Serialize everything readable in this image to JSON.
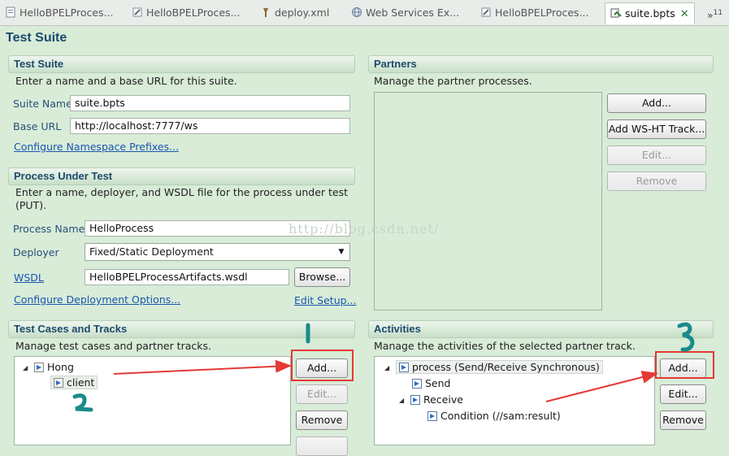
{
  "tabs": [
    {
      "label": "HelloBPELProces...",
      "icon": "bpel-file-icon"
    },
    {
      "label": "HelloBPELProces...",
      "icon": "bpel-editor-icon"
    },
    {
      "label": "deploy.xml",
      "icon": "deploy-file-icon"
    },
    {
      "label": "Web Services Ex...",
      "icon": "globe-icon"
    },
    {
      "label": "HelloBPELProces...",
      "icon": "bpel-editor-icon"
    },
    {
      "label": "suite.bpts",
      "icon": "test-suite-icon",
      "active": true
    }
  ],
  "page_title": "Test Suite",
  "test_suite": {
    "header": "Test Suite",
    "description": "Enter a name and a base URL for this suite.",
    "suite_name_label": "Suite Name",
    "suite_name_value": "suite.bpts",
    "base_url_label": "Base URL",
    "base_url_value": "http://localhost:7777/ws",
    "namespace_link": "Configure Namespace Prefixes..."
  },
  "process_under_test": {
    "header": "Process Under Test",
    "description_line1": "Enter a name, deployer, and WSDL file for the process under test",
    "description_line2": "(PUT).",
    "process_name_label": "Process Name",
    "process_name_value": "HelloProcess",
    "deployer_label": "Deployer",
    "deployer_value": "Fixed/Static Deployment",
    "wsdl_label": "WSDL",
    "wsdl_value": "HelloBPELProcessArtifacts.wsdl",
    "browse_button": "Browse...",
    "deployment_link": "Configure Deployment Options...",
    "edit_setup_link": "Edit Setup..."
  },
  "test_cases": {
    "header": "Test Cases and Tracks",
    "description": "Manage test cases and partner tracks.",
    "tree": [
      {
        "label": "Hong",
        "expanded": true
      },
      {
        "label": "client",
        "selected": true
      }
    ],
    "add_button": "Add...",
    "edit_button": "Edit...",
    "remove_button": "Remove"
  },
  "partners": {
    "header": "Partners",
    "description": "Manage the partner processes.",
    "add_button": "Add...",
    "add_ws_ht_button": "Add WS-HT Track...",
    "edit_button": "Edit...",
    "remove_button": "Remove"
  },
  "activities": {
    "header": "Activities",
    "description": "Manage the activities of the selected partner track.",
    "tree": [
      {
        "label": "process (Send/Receive Synchronous)",
        "expanded": true
      },
      {
        "label": "Send"
      },
      {
        "label": "Receive",
        "expanded": true
      },
      {
        "label": "Condition (//sam:result)"
      }
    ],
    "add_button": "Add...",
    "edit_button": "Edit...",
    "remove_button": "Remove"
  },
  "annotations": {
    "watermark": "http://blog.csdn.net/",
    "highlight_color": "#e53935",
    "marker_color": "#1a8a8a"
  }
}
